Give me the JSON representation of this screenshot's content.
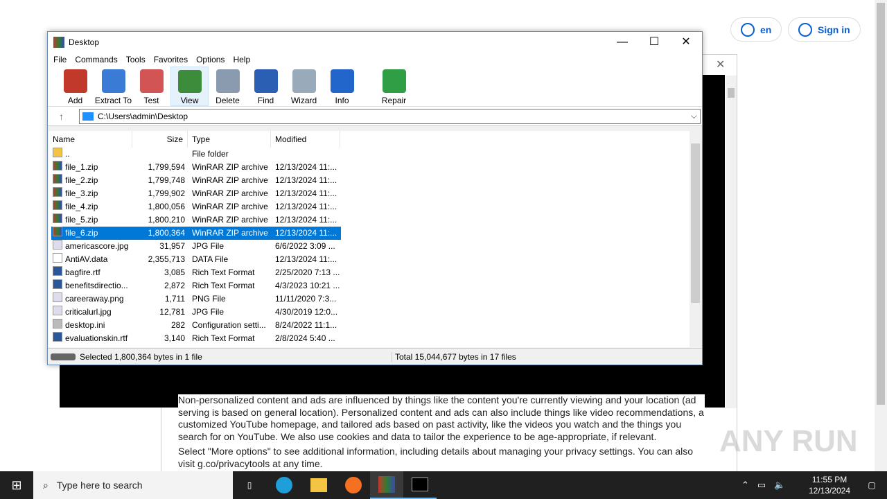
{
  "browser": {
    "lang_label": "en",
    "signin_label": "Sign in",
    "consent_paragraphs": [
      "Non-personalized content and ads are influenced by things like the content you're currently viewing and your location (ad serving is based on general location). Personalized content and ads can also include things like video recommendations, a customized YouTube homepage, and tailored ads based on past activity, like the videos you watch and the things you search for on YouTube. We also use cookies and data to tailor the experience to be age-appropriate, if relevant.",
      "Select \"More options\" to see additional information, including details about managing your privacy settings. You can also visit g.co/privacytools at any time."
    ]
  },
  "window": {
    "title": "Desktop",
    "minimize": "—",
    "maximize": "☐",
    "close": "✕"
  },
  "menu": [
    "File",
    "Commands",
    "Tools",
    "Favorites",
    "Options",
    "Help"
  ],
  "toolbar": [
    {
      "label": "Add",
      "color": "#c0392b"
    },
    {
      "label": "Extract To",
      "color": "#3a7bd5"
    },
    {
      "label": "Test",
      "color": "#d35454"
    },
    {
      "label": "View",
      "color": "#3c8c3c"
    },
    {
      "label": "Delete",
      "color": "#8a9bb0"
    },
    {
      "label": "Find",
      "color": "#2b5fb4"
    },
    {
      "label": "Wizard",
      "color": "#9ab"
    },
    {
      "label": "Info",
      "color": "#2266cc"
    },
    {
      "label": "Repair",
      "color": "#2f9e44"
    }
  ],
  "address": {
    "path": "C:\\Users\\admin\\Desktop",
    "up": "↑"
  },
  "columns": [
    "Name",
    "Size",
    "Type",
    "Modified"
  ],
  "files": [
    {
      "name": "..",
      "size": "",
      "type": "File folder",
      "modified": "",
      "icon": "folder"
    },
    {
      "name": "file_1.zip",
      "size": "1,799,594",
      "type": "WinRAR ZIP archive",
      "modified": "12/13/2024 11:...",
      "icon": "rar"
    },
    {
      "name": "file_2.zip",
      "size": "1,799,748",
      "type": "WinRAR ZIP archive",
      "modified": "12/13/2024 11:...",
      "icon": "rar"
    },
    {
      "name": "file_3.zip",
      "size": "1,799,902",
      "type": "WinRAR ZIP archive",
      "modified": "12/13/2024 11:...",
      "icon": "rar"
    },
    {
      "name": "file_4.zip",
      "size": "1,800,056",
      "type": "WinRAR ZIP archive",
      "modified": "12/13/2024 11:...",
      "icon": "rar"
    },
    {
      "name": "file_5.zip",
      "size": "1,800,210",
      "type": "WinRAR ZIP archive",
      "modified": "12/13/2024 11:...",
      "icon": "rar"
    },
    {
      "name": "file_6.zip",
      "size": "1,800,364",
      "type": "WinRAR ZIP archive",
      "modified": "12/13/2024 11:...",
      "icon": "rar",
      "selected": true
    },
    {
      "name": "americascore.jpg",
      "size": "31,957",
      "type": "JPG File",
      "modified": "6/6/2022 3:09 ...",
      "icon": "image"
    },
    {
      "name": "AntiAV.data",
      "size": "2,355,713",
      "type": "DATA File",
      "modified": "12/13/2024 11:...",
      "icon": "file"
    },
    {
      "name": "bagfire.rtf",
      "size": "3,085",
      "type": "Rich Text Format",
      "modified": "2/25/2020 7:13 ...",
      "icon": "word"
    },
    {
      "name": "benefitsdirectio...",
      "size": "2,872",
      "type": "Rich Text Format",
      "modified": "4/3/2023 10:21 ...",
      "icon": "word"
    },
    {
      "name": "careeraway.png",
      "size": "1,711",
      "type": "PNG File",
      "modified": "11/11/2020 7:3...",
      "icon": "image"
    },
    {
      "name": "criticalurl.jpg",
      "size": "12,781",
      "type": "JPG File",
      "modified": "4/30/2019 12:0...",
      "icon": "image"
    },
    {
      "name": "desktop.ini",
      "size": "282",
      "type": "Configuration setti...",
      "modified": "8/24/2022 11:1...",
      "icon": "settings"
    },
    {
      "name": "evaluationskin.rtf",
      "size": "3,140",
      "type": "Rich Text Format",
      "modified": "2/8/2024 5:40 ...",
      "icon": "word"
    }
  ],
  "status": {
    "left": "Selected 1,800,364 bytes in 1 file",
    "right": "Total 15,044,677 bytes in 17 files"
  },
  "taskbar": {
    "search_placeholder": "Type here to search",
    "time": "11:55 PM",
    "date": "12/13/2024"
  },
  "watermark": "ANY RUN"
}
